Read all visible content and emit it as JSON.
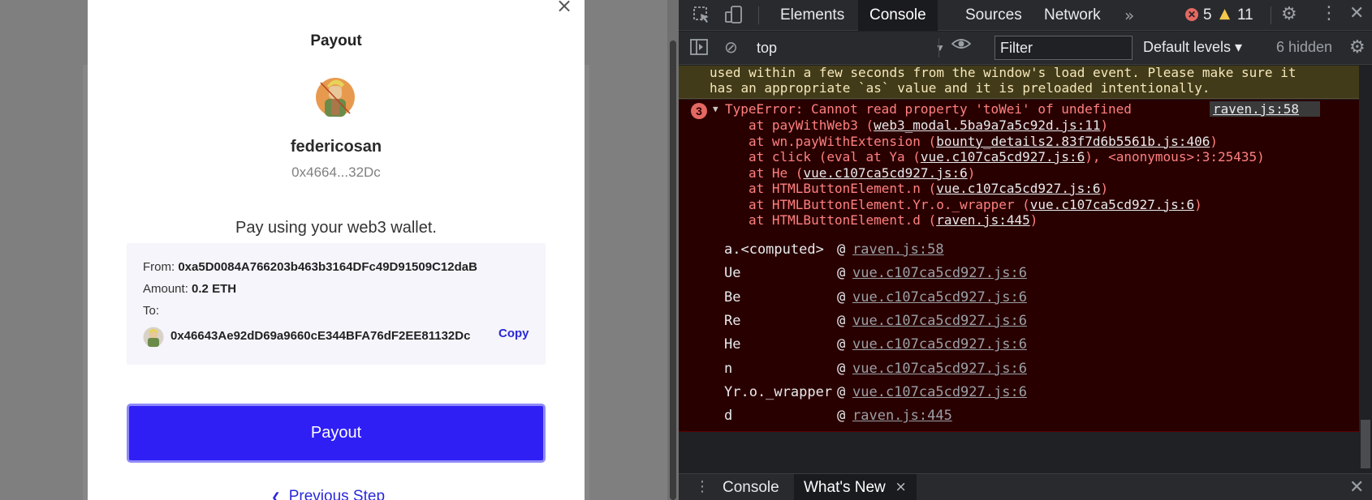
{
  "modal": {
    "close_glyph": "×",
    "title": "Payout",
    "username": "federicosan",
    "address_short": "0x4664...32Dc",
    "instruction": "Pay using your web3 wallet.",
    "from_label": "From:",
    "from_value": "0xa5D0084A766203b463b3164DFc49D91509C12daB",
    "amount_label": "Amount:",
    "amount_value": "0.2 ETH",
    "to_label": "To:",
    "to_value": "0x46643Ae92dD69a9660cE344BFA76dF2EE81132Dc",
    "copy_label": "Copy",
    "payout_button": "Payout",
    "previous_step": "Previous Step"
  },
  "devtools": {
    "tabs": [
      "Elements",
      "Console",
      "Sources",
      "Network"
    ],
    "more_tabs_glyph": "»",
    "error_count": "5",
    "warning_count": "11",
    "context": "top",
    "filter_placeholder": "Filter",
    "levels": "Default levels ▾",
    "hidden_count": "6 hidden",
    "warning_lines": [
      "used within a few seconds from the window's load event. Please make sure it",
      "has an appropriate `as` value and it is preloaded intentionally."
    ],
    "error": {
      "count": "3",
      "message": "TypeError: Cannot read property 'toWei' of undefined",
      "source": "raven.js:58",
      "stack": [
        {
          "prefix": "at payWithWeb3 (",
          "link": "web3_modal.5ba9a7a5c92d.js:11",
          "suffix": ")"
        },
        {
          "prefix": "at wn.payWithExtension (",
          "link": "bounty_details2.83f7d6b5561b.js:406",
          "suffix": ")"
        },
        {
          "prefix": "at click (eval at Ya (",
          "link": "vue.c107ca5cd927.js:6",
          "suffix": "), <anonymous>:3:25435)"
        },
        {
          "prefix": "at He (",
          "link": "vue.c107ca5cd927.js:6",
          "suffix": ")"
        },
        {
          "prefix": "at HTMLButtonElement.n (",
          "link": "vue.c107ca5cd927.js:6",
          "suffix": ")"
        },
        {
          "prefix": "at HTMLButtonElement.Yr.o._wrapper (",
          "link": "vue.c107ca5cd927.js:6",
          "suffix": ")"
        },
        {
          "prefix": "at HTMLButtonElement.d (",
          "link": "raven.js:445",
          "suffix": ")"
        }
      ],
      "trace": [
        {
          "fn": "a.<computed>",
          "link": "raven.js:58"
        },
        {
          "fn": "Ue",
          "link": "vue.c107ca5cd927.js:6"
        },
        {
          "fn": "Be",
          "link": "vue.c107ca5cd927.js:6"
        },
        {
          "fn": "Re",
          "link": "vue.c107ca5cd927.js:6"
        },
        {
          "fn": "He",
          "link": "vue.c107ca5cd927.js:6"
        },
        {
          "fn": "n",
          "link": "vue.c107ca5cd927.js:6"
        },
        {
          "fn": "Yr.o._wrapper",
          "link": "vue.c107ca5cd927.js:6"
        },
        {
          "fn": "d",
          "link": "raven.js:445"
        }
      ],
      "at_glyph": "@"
    },
    "prompt_glyph": "›",
    "drawer_tabs": [
      "Console",
      "What's New"
    ],
    "drawer_close_glyph": "×",
    "colors": {
      "error": "#ff8080",
      "accent": "#4d8ff7",
      "payout_button": "#2f1ff5"
    },
    "icons": [
      "inspect-icon",
      "device-icon",
      "settings-icon",
      "kebab-icon",
      "close-icon",
      "sidebar-toggle-icon",
      "clear-console-icon",
      "live-expression-icon",
      "error-icon",
      "warning-icon"
    ]
  }
}
